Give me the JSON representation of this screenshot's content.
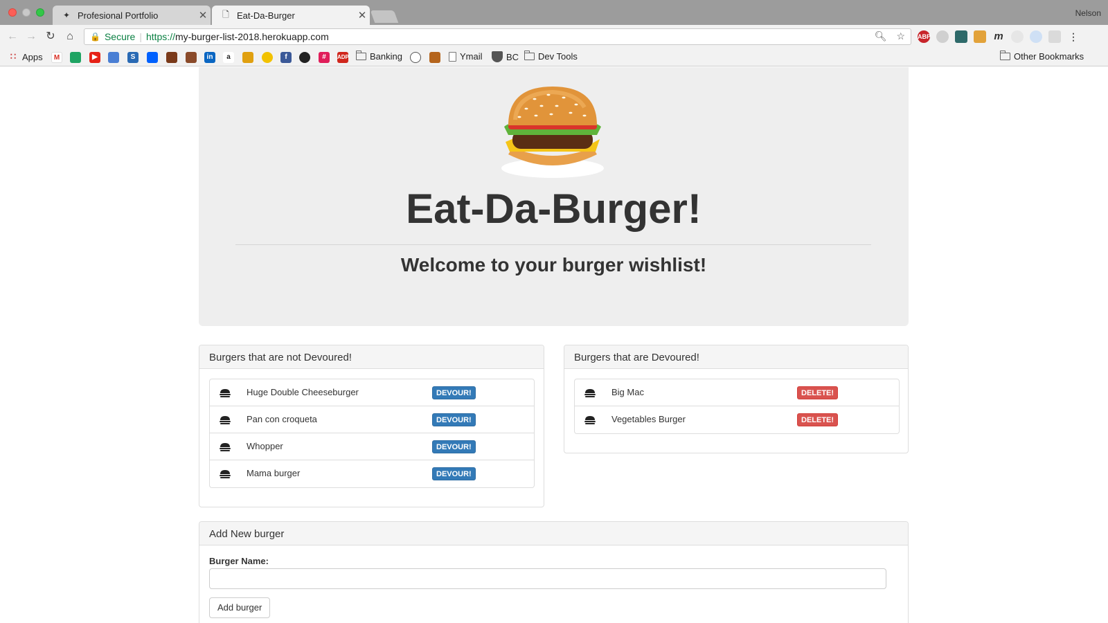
{
  "browser": {
    "tabs": [
      {
        "title": "Profesional Portfolio",
        "active": false,
        "icon": "portfolio-favicon"
      },
      {
        "title": "Eat-Da-Burger",
        "active": true,
        "icon": "document-icon"
      }
    ],
    "profile_name": "Nelson",
    "address": {
      "secure_label": "Secure",
      "protocol": "https://",
      "host": "my-burger-list-2018.herokuapp.com"
    },
    "bookmarks": [
      {
        "label": "Apps",
        "icon": "apps-grid-icon"
      },
      {
        "label": "Banking",
        "icon": "folder-icon"
      },
      {
        "label": "Ymail",
        "icon": "page-icon"
      },
      {
        "label": "BC",
        "icon": "shield-icon"
      },
      {
        "label": "Dev Tools",
        "icon": "folder-icon"
      }
    ],
    "other_bookmarks_label": "Other Bookmarks"
  },
  "hero": {
    "title": "Eat-Da-Burger!",
    "subtitle": "Welcome to your burger wishlist!"
  },
  "not_devoured": {
    "heading": "Burgers that are not Devoured!",
    "button_label": "DEVOUR!",
    "items": [
      "Huge Double Cheeseburger",
      "Pan con croqueta",
      "Whopper",
      "Mama burger"
    ]
  },
  "devoured": {
    "heading": "Burgers that are Devoured!",
    "button_label": "DELETE!",
    "items": [
      "Big Mac",
      "Vegetables Burger"
    ]
  },
  "add_form": {
    "heading": "Add New burger",
    "label": "Burger Name:",
    "value": "",
    "button_label": "Add burger"
  },
  "colors": {
    "primary": "#337ab7",
    "danger": "#d9534f",
    "jumbotron": "#eeeeee"
  }
}
